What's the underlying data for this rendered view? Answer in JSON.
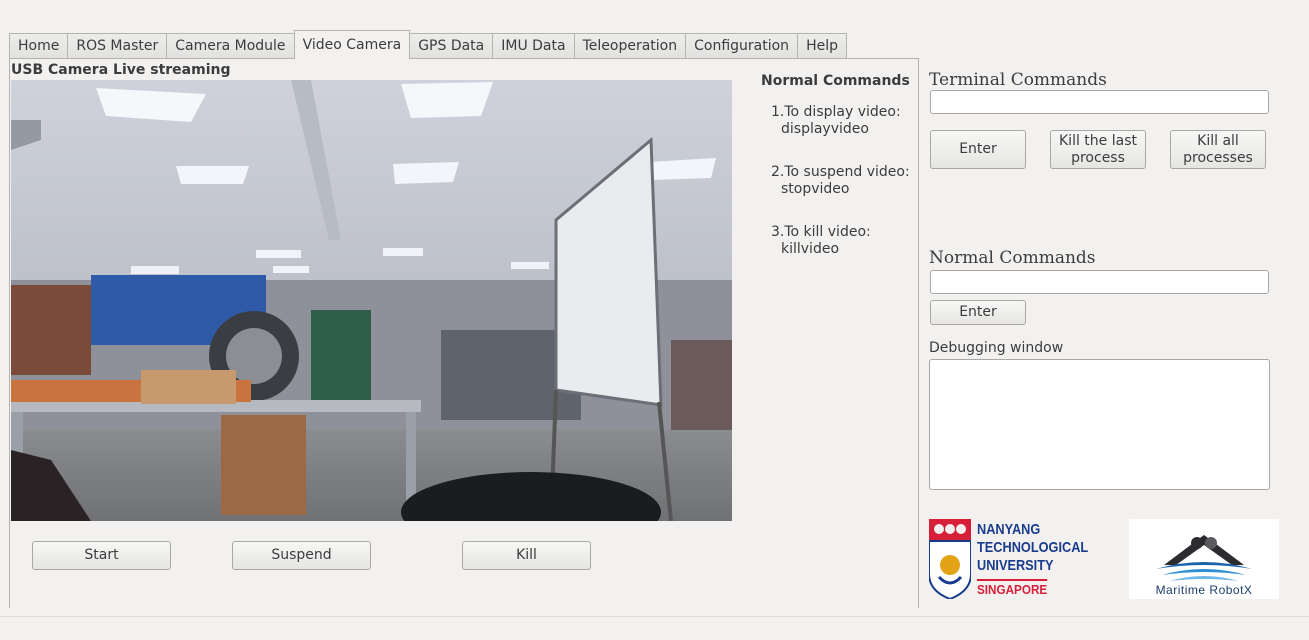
{
  "tabs": [
    "Home",
    "ROS Master",
    "Camera Module",
    "Video Camera",
    "GPS Data",
    "IMU Data",
    "Teleoperation",
    "Configuration",
    "Help"
  ],
  "active_tab": "Video Camera",
  "video": {
    "title": "USB Camera Live streaming",
    "start_label": "Start",
    "suspend_label": "Suspend",
    "kill_label": "Kill"
  },
  "normal_commands_info": {
    "heading": "Normal Commands",
    "items": [
      {
        "line1": "1.To display video:",
        "line2": "displayvideo"
      },
      {
        "line1": "2.To suspend video:",
        "line2": "stopvideo"
      },
      {
        "line1": "3.To kill video:",
        "line2": "killvideo"
      }
    ]
  },
  "terminal": {
    "title": "Terminal Commands",
    "input_value": "",
    "enter_label": "Enter",
    "kill_last_label_1": "Kill the last",
    "kill_last_label_2": "process",
    "kill_all_label_1": "Kill all",
    "kill_all_label_2": "processes"
  },
  "normal": {
    "title": "Normal Commands",
    "input_value": "",
    "enter_label": "Enter"
  },
  "debug": {
    "title": "Debugging window",
    "content": ""
  },
  "logos": {
    "ntu_line1": "NANYANG",
    "ntu_line2": "TECHNOLOGICAL",
    "ntu_line3": "UNIVERSITY",
    "ntu_line4": "SINGAPORE",
    "robotx": "Maritime RobotX"
  },
  "colors": {
    "ntu_blue": "#1a3c8c",
    "ntu_red": "#d71f3a",
    "robotx_blue": "#1b63a8"
  }
}
